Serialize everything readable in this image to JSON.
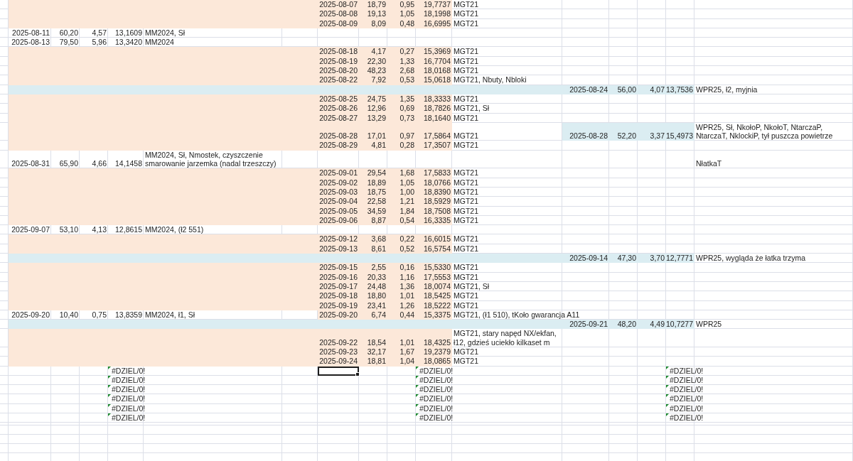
{
  "rows": [
    {
      "kind": "entry",
      "middle": {
        "date": "2025-08-07",
        "column_2": "18,79",
        "column_3": "0,95",
        "column_4": "19,7737",
        "note": "MGT21"
      }
    },
    {
      "kind": "entry",
      "middle": {
        "date": "2025-08-08",
        "column_2": "19,13",
        "column_3": "1,05",
        "column_4": "18,1998",
        "note": "MGT21"
      }
    },
    {
      "kind": "entry",
      "middle": {
        "date": "2025-08-09",
        "column_2": "8,09",
        "column_3": "0,48",
        "column_4": "16,6995",
        "note": "MGT21"
      }
    },
    {
      "kind": "entry",
      "left": {
        "date": "2025-08-11",
        "column_2": "60,20",
        "column_3": "4,57",
        "column_4": "13,1609",
        "note": "MM2024, Sł"
      }
    },
    {
      "kind": "entry",
      "left": {
        "date": "2025-08-13",
        "column_2": "79,50",
        "column_3": "5,96",
        "column_4": "13,3420",
        "note": "MM2024"
      }
    },
    {
      "kind": "entry",
      "middle": {
        "date": "2025-08-18",
        "column_2": "4,17",
        "column_3": "0,27",
        "column_4": "15,3969",
        "note": "MGT21"
      }
    },
    {
      "kind": "entry",
      "middle": {
        "date": "2025-08-19",
        "column_2": "22,30",
        "column_3": "1,33",
        "column_4": "16,7704",
        "note": "MGT21"
      }
    },
    {
      "kind": "entry",
      "middle": {
        "date": "2025-08-20",
        "column_2": "48,23",
        "column_3": "2,68",
        "column_4": "18,0168",
        "note": "MGT21"
      }
    },
    {
      "kind": "entry",
      "middle": {
        "date": "2025-08-22",
        "column_2": "7,92",
        "column_3": "0,53",
        "column_4": "15,0618",
        "note": "MGT21, Nbuty, Nbloki"
      }
    },
    {
      "kind": "entry",
      "right": {
        "date": "2025-08-24",
        "column_2": "56,00",
        "column_3": "4,07",
        "column_4": "13,7536",
        "note": "WPR25, ł2, myjnia"
      }
    },
    {
      "kind": "entry",
      "middle": {
        "date": "2025-08-25",
        "column_2": "24,75",
        "column_3": "1,35",
        "column_4": "18,3333",
        "note": "MGT21"
      }
    },
    {
      "kind": "entry",
      "middle": {
        "date": "2025-08-26",
        "column_2": "12,96",
        "column_3": "0,69",
        "column_4": "18,7826",
        "note": "MGT21, Sł"
      }
    },
    {
      "kind": "entry",
      "middle": {
        "date": "2025-08-27",
        "column_2": "13,29",
        "column_3": "0,73",
        "column_4": "18,1640",
        "note": "MGT21"
      }
    },
    {
      "kind": "entry",
      "middle": {
        "date": "2025-08-28",
        "column_2": "17,01",
        "column_3": "0,97",
        "column_4": "17,5864",
        "note": "MGT21"
      },
      "right": {
        "date": "2025-08-28",
        "column_2": "52,20",
        "column_3": "3,37",
        "column_4": "15,4973",
        "note": "WPR25, Sł, NkołoP, NkołoT, NtarczaP, NtarczaT, NklockiP, tył puszcza powietrze"
      }
    },
    {
      "kind": "entry",
      "middle": {
        "date": "2025-08-29",
        "column_2": "4,81",
        "column_3": "0,28",
        "column_4": "17,3507",
        "note": "MGT21"
      }
    },
    {
      "kind": "entry",
      "left": {
        "date": "2025-08-31",
        "column_2": "65,90",
        "column_3": "4,66",
        "column_4": "14,1458",
        "note": "MM2024, Sł, Nmostek, czyszczenie smarowanie jarzemka (nadal trzeszczy)"
      },
      "right": {
        "note": "NłatkaT"
      }
    },
    {
      "kind": "entry",
      "middle": {
        "date": "2025-09-01",
        "column_2": "29,54",
        "column_3": "1,68",
        "column_4": "17,5833",
        "note": "MGT21"
      }
    },
    {
      "kind": "entry",
      "middle": {
        "date": "2025-09-02",
        "column_2": "18,89",
        "column_3": "1,05",
        "column_4": "18,0766",
        "note": "MGT21"
      }
    },
    {
      "kind": "entry",
      "middle": {
        "date": "2025-09-03",
        "column_2": "18,75",
        "column_3": "1,00",
        "column_4": "18,8390",
        "note": "MGT21"
      }
    },
    {
      "kind": "entry",
      "middle": {
        "date": "2025-09-04",
        "column_2": "22,58",
        "column_3": "1,21",
        "column_4": "18,5929",
        "note": "MGT21"
      }
    },
    {
      "kind": "entry",
      "middle": {
        "date": "2025-09-05",
        "column_2": "34,59",
        "column_3": "1,84",
        "column_4": "18,7508",
        "note": "MGT21"
      }
    },
    {
      "kind": "entry",
      "middle": {
        "date": "2025-09-06",
        "column_2": "8,87",
        "column_3": "0,54",
        "column_4": "16,3335",
        "note": "MGT21"
      }
    },
    {
      "kind": "entry",
      "left": {
        "date": "2025-09-07",
        "column_2": "53,10",
        "column_3": "4,13",
        "column_4": "12,8615",
        "note": "MM2024, (ł2 551)"
      }
    },
    {
      "kind": "entry",
      "middle": {
        "date": "2025-09-12",
        "column_2": "3,68",
        "column_3": "0,22",
        "column_4": "16,6015",
        "note": "MGT21"
      }
    },
    {
      "kind": "entry",
      "middle": {
        "date": "2025-09-13",
        "column_2": "8,61",
        "column_3": "0,52",
        "column_4": "16,5754",
        "note": "MGT21"
      }
    },
    {
      "kind": "entry",
      "right": {
        "date": "2025-09-14",
        "column_2": "47,30",
        "column_3": "3,70",
        "column_4": "12,7771",
        "note": "WPR25, wygląda że łatka trzyma"
      }
    },
    {
      "kind": "entry",
      "middle": {
        "date": "2025-09-15",
        "column_2": "2,55",
        "column_3": "0,16",
        "column_4": "15,5330",
        "note": "MGT21"
      }
    },
    {
      "kind": "entry",
      "middle": {
        "date": "2025-09-16",
        "column_2": "20,33",
        "column_3": "1,16",
        "column_4": "17,5553",
        "note": "MGT21"
      }
    },
    {
      "kind": "entry",
      "middle": {
        "date": "2025-09-17",
        "column_2": "24,48",
        "column_3": "1,36",
        "column_4": "18,0074",
        "note": "MGT21,  Sł"
      }
    },
    {
      "kind": "entry",
      "middle": {
        "date": "2025-09-18",
        "column_2": "18,80",
        "column_3": "1,01",
        "column_4": "18,5425",
        "note": "MGT21"
      }
    },
    {
      "kind": "entry",
      "middle": {
        "date": "2025-09-19",
        "column_2": "23,41",
        "column_3": "1,26",
        "column_4": "18,5222",
        "note": "MGT21"
      }
    },
    {
      "kind": "entry",
      "left": {
        "date": "2025-09-20",
        "column_2": "10,40",
        "column_3": "0,75",
        "column_4": "13,8359",
        "note": "MM2024, ł1, Sł"
      },
      "middle": {
        "date": "2025-09-20",
        "column_2": "6,74",
        "column_3": "0,44",
        "column_4": "15,3375",
        "note": "MGT21, (ł1 510), tKoło gwarancja A11"
      }
    },
    {
      "kind": "entry",
      "right": {
        "date": "2025-09-21",
        "column_2": "48,20",
        "column_3": "4,49",
        "column_4": "10,7277",
        "note": "WPR25"
      }
    },
    {
      "kind": "entry",
      "middle": {
        "date": "2025-09-22",
        "column_2": "18,54",
        "column_3": "1,01",
        "column_4": "18,4325",
        "note": "MGT21, stary napęd NX/ekfan, ł12, gdzieś uciekło kilkaset m"
      }
    },
    {
      "kind": "entry",
      "middle": {
        "date": "2025-09-23",
        "column_2": "32,17",
        "column_3": "1,67",
        "column_4": "19,2379",
        "note": "MGT21"
      }
    },
    {
      "kind": "entry",
      "middle": {
        "date": "2025-09-24",
        "column_2": "18,81",
        "column_3": "1,04",
        "column_4": "18,0865",
        "note": "MGT21"
      }
    },
    {
      "kind": "error",
      "left": {
        "column_4": "#DZIEL/0!"
      },
      "middle": {
        "column_4": "#DZIEL/0!",
        "date_selected": true
      },
      "right": {
        "column_4": "#DZIEL/0!"
      }
    },
    {
      "kind": "error",
      "left": {
        "column_4": "#DZIEL/0!"
      },
      "middle": {
        "column_4": "#DZIEL/0!",
        "date_selected": false
      },
      "right": {
        "column_4": "#DZIEL/0!"
      }
    },
    {
      "kind": "error",
      "left": {
        "column_4": "#DZIEL/0!"
      },
      "middle": {
        "column_4": "#DZIEL/0!",
        "date_selected": false
      },
      "right": {
        "column_4": "#DZIEL/0!"
      }
    },
    {
      "kind": "error",
      "left": {
        "column_4": "#DZIEL/0!"
      },
      "middle": {
        "column_4": "#DZIEL/0!",
        "date_selected": false
      },
      "right": {
        "column_4": "#DZIEL/0!"
      }
    },
    {
      "kind": "error",
      "left": {
        "column_4": "#DZIEL/0!"
      },
      "middle": {
        "column_4": "#DZIEL/0!",
        "date_selected": false
      },
      "right": {
        "column_4": "#DZIEL/0!"
      }
    },
    {
      "kind": "error",
      "left": {
        "column_4": "#DZIEL/0!"
      },
      "middle": {
        "column_4": "#DZIEL/0!",
        "date_selected": false
      },
      "right": {
        "column_4": "#DZIEL/0!"
      }
    }
  ]
}
